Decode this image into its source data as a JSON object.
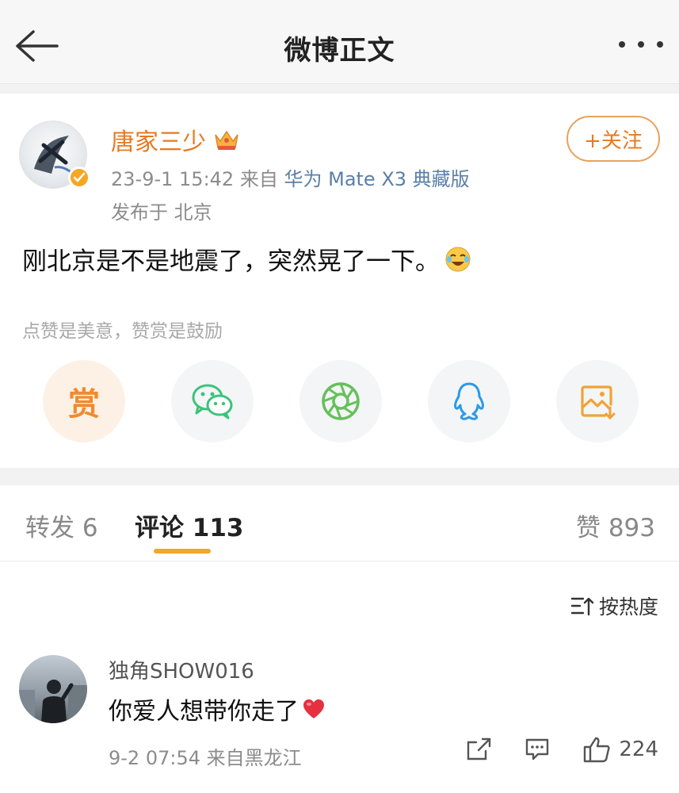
{
  "header": {
    "title": "微博正文"
  },
  "post": {
    "username": "唐家三少",
    "meta_time": "23-9-1 15:42",
    "meta_from": "来自",
    "meta_device": "华为 Mate X3 典藏版",
    "location": "发布于 北京",
    "follow_label": "+关注",
    "text": "刚北京是不是地震了，突然晃了一下。",
    "reward_hint": "点赞是美意，赞赏是鼓励",
    "reward_label": "赏"
  },
  "share_items": [
    {
      "icon": "reward-icon"
    },
    {
      "icon": "wechat-icon"
    },
    {
      "icon": "moments-icon"
    },
    {
      "icon": "qq-icon"
    },
    {
      "icon": "save-image-icon"
    }
  ],
  "tabs": {
    "repost": "转发 6",
    "comment": "评论 113",
    "like": "赞 893"
  },
  "comments": {
    "sort_label": "按热度",
    "items": [
      {
        "name": "独角SHOW016",
        "text": "你爱人想带你走了",
        "time": "9-2 07:54",
        "from": "来自黑龙江",
        "likes": "224"
      }
    ]
  },
  "colors": {
    "accent": "#e8791f",
    "tab_underline": "#f3a52c",
    "link_blue": "#5b7fa8"
  }
}
